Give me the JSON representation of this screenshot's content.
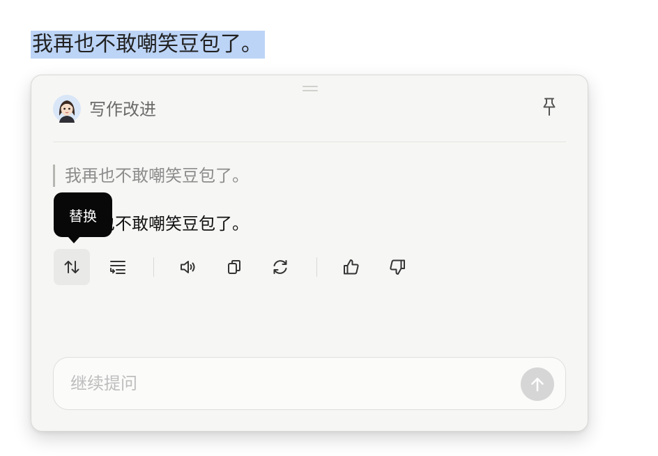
{
  "document": {
    "selected_text": "我再也不敢嘲笑豆包了。"
  },
  "panel": {
    "title": "写作改进",
    "avatar_icon": "avatar-icon",
    "pin_icon": "pin-icon",
    "original_quote": "我再也不敢嘲笑豆包了。",
    "result_text": "我再也不敢嘲笑豆包了。",
    "tooltip": "替换",
    "toolbar": [
      {
        "name": "replace-button",
        "icon": "swap-vertical-icon",
        "active": true
      },
      {
        "name": "insert-below-button",
        "icon": "insert-lines-icon",
        "active": false
      },
      {
        "name": "read-aloud-button",
        "icon": "speaker-icon",
        "active": false
      },
      {
        "name": "copy-button",
        "icon": "copy-icon",
        "active": false
      },
      {
        "name": "regenerate-button",
        "icon": "refresh-icon",
        "active": false
      },
      {
        "name": "like-button",
        "icon": "thumbs-up-icon",
        "active": false
      },
      {
        "name": "dislike-button",
        "icon": "thumbs-down-icon",
        "active": false
      }
    ],
    "input": {
      "placeholder": "继续提问",
      "value": ""
    },
    "send_icon": "arrow-up-icon"
  },
  "colors": {
    "selection_highlight": "#bcd4f6",
    "panel_background": "#f6f6f4",
    "tooltip_background": "#080808",
    "send_button_disabled": "#d6d6d6"
  }
}
